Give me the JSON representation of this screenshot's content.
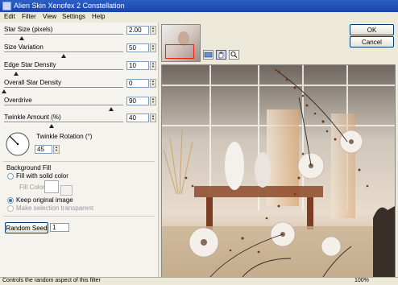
{
  "window": {
    "title": "Alien Skin Xenofex 2 Constellation"
  },
  "menu": [
    "Edit",
    "Filter",
    "View",
    "Settings",
    "Help"
  ],
  "controls": {
    "star_size": {
      "label": "Star Size (pixels)",
      "value": "2.00",
      "level": 0.15
    },
    "size_variation": {
      "label": "Size Variation",
      "value": "50",
      "level": 0.5
    },
    "edge_star_density": {
      "label": "Edge Star Density",
      "value": "10",
      "level": 0.1
    },
    "overall_star_density": {
      "label": "Overall Star Density",
      "value": "0",
      "level": 0.0
    },
    "overdrive": {
      "label": "Overdrive",
      "value": "90",
      "level": 0.9
    },
    "twinkle_amount": {
      "label": "Twinkle Amount (%)",
      "value": "40",
      "level": 0.4
    }
  },
  "twinkle_rotation": {
    "label": "Twinkle Rotation (°)",
    "value": "45"
  },
  "background_fill": {
    "title": "Background Fill",
    "fill_solid_label": "Fill with solid color",
    "fill_color_label": "Fill Color",
    "keep_original_label": "Keep original image",
    "make_transparent_label": "Make selection transparent"
  },
  "random_seed": {
    "label": "Random Seed",
    "value": "1"
  },
  "buttons": {
    "ok": "OK",
    "cancel": "Cancel"
  },
  "status": {
    "text": "Controls the random aspect of this filter",
    "zoom": "100%"
  },
  "colors": {
    "titlebar": "#1f50b5",
    "accent": "#27a",
    "star": "#6b3a1f"
  }
}
